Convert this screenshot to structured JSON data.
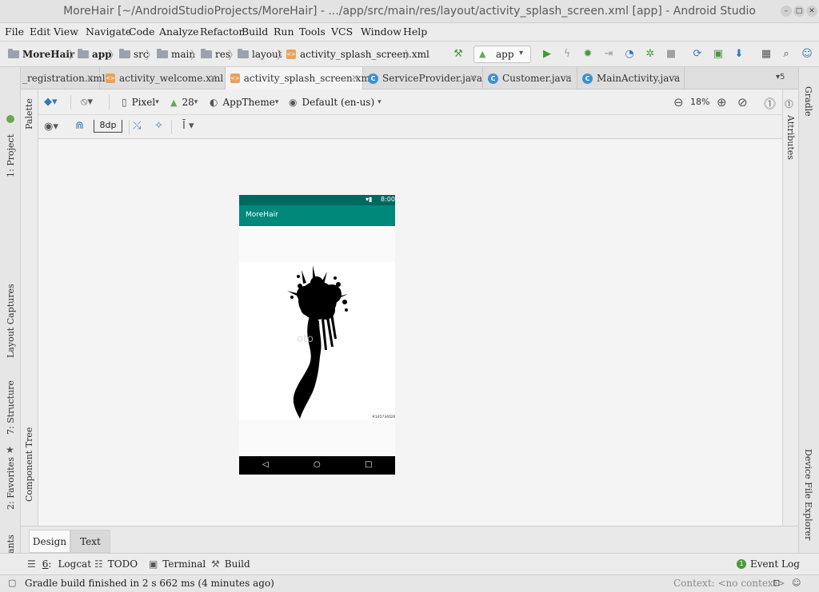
{
  "window": {
    "title": "MoreHair [~/AndroidStudioProjects/MoreHair] - .../app/src/main/res/layout/activity_splash_screen.xml [app] - Android Studio",
    "controls": [
      "minimize",
      "maximize",
      "close"
    ]
  },
  "menu": [
    "File",
    "Edit",
    "View",
    "Navigate",
    "Code",
    "Analyze",
    "Refactor",
    "Build",
    "Run",
    "Tools",
    "VCS",
    "Window",
    "Help"
  ],
  "breadcrumb": [
    "MoreHair",
    "app",
    "src",
    "main",
    "res",
    "layout",
    "activity_splash_screen.xml"
  ],
  "run_config": "app",
  "tabs": [
    {
      "label": "_registration.xml",
      "type": "xml"
    },
    {
      "label": "activity_welcome.xml",
      "type": "xml"
    },
    {
      "label": "activity_splash_screen.xml",
      "type": "xml",
      "active": true
    },
    {
      "label": "ServiceProvider.java",
      "type": "class"
    },
    {
      "label": "Customer.java",
      "type": "class"
    },
    {
      "label": "MainActivity.java",
      "type": "class"
    }
  ],
  "tab_overflow": "▾5",
  "left_tools": {
    "project": "1: Project",
    "layout_captures": "Layout Captures",
    "structure": "7: Structure",
    "favorites": "2: Favorites",
    "build_variants": "Build Variants",
    "palette": "Palette",
    "component_tree": "Component Tree"
  },
  "right_tools": {
    "gradle": "Gradle",
    "attributes": "Attributes",
    "device_file_explorer": "Device File Explorer"
  },
  "design_toolbar": {
    "device": "Pixel",
    "api": "28",
    "theme": "AppTheme",
    "locale": "Default (en-us)",
    "zoom": "18%",
    "margin": "8dp"
  },
  "phone": {
    "time": "8:00",
    "app_title": "MoreHair",
    "stock_id": "#145734026",
    "colors": {
      "status": "#00695f",
      "appbar": "#00897b",
      "nav": "#000000"
    }
  },
  "editor_tabs": {
    "design": "Design",
    "text": "Text"
  },
  "tool_windows": {
    "logcat_num": "6",
    "logcat": "Logcat",
    "todo": "TODO",
    "terminal": "Terminal",
    "build": "Build",
    "event_log": "Event Log"
  },
  "status": {
    "message": "Gradle build finished in 2 s 662 ms (4 minutes ago)",
    "context": "Context: <no context>"
  }
}
